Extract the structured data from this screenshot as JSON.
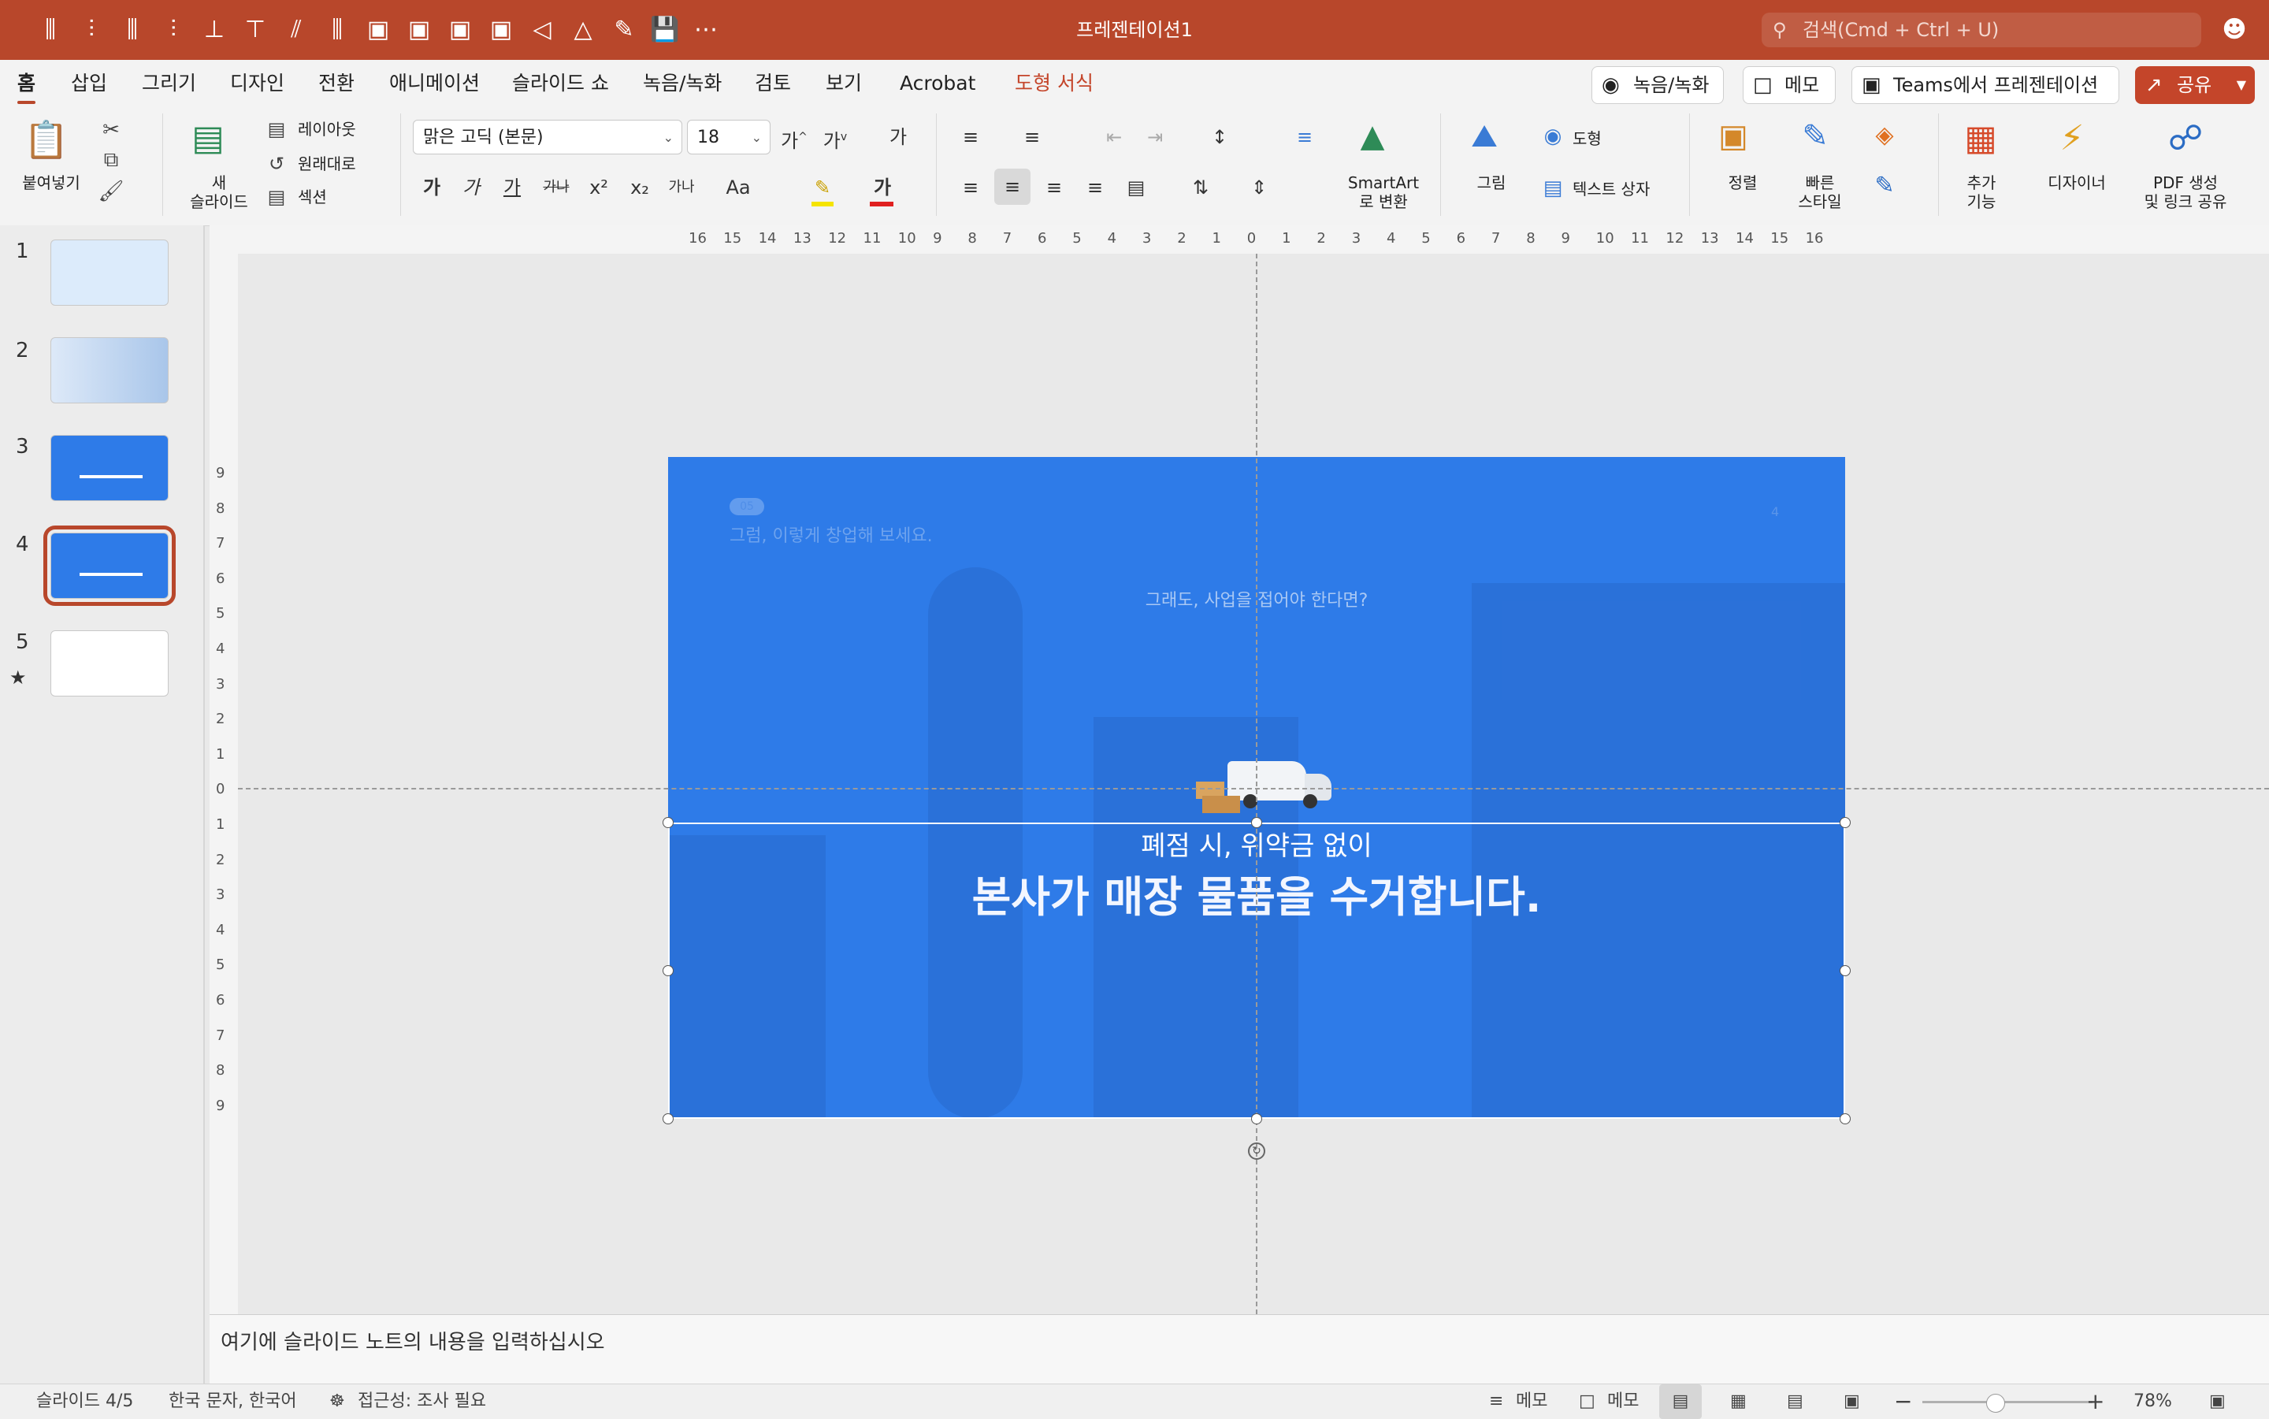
{
  "window": {
    "title": "프레젠테이션1",
    "search_placeholder": "검색(Cmd + Ctrl + U)",
    "accent_color": "#b8472b"
  },
  "quick_access_icons": [
    "align-center-icon",
    "align-middle-icon",
    "distribute-horizontal-icon",
    "align-vertical-center-icon",
    "align-bottom-icon",
    "align-top-icon",
    "align-right-icon",
    "align-left-icon",
    "bring-forward-icon",
    "send-backward-icon",
    "bring-to-front-icon",
    "send-to-back-icon",
    "flip-horizontal-icon",
    "flip-vertical-icon",
    "edit-icon",
    "save-icon",
    "more-icon"
  ],
  "tabs": [
    {
      "label": "홈",
      "active": true
    },
    {
      "label": "삽입"
    },
    {
      "label": "그리기"
    },
    {
      "label": "디자인"
    },
    {
      "label": "전환"
    },
    {
      "label": "애니메이션"
    },
    {
      "label": "슬라이드 쇼"
    },
    {
      "label": "녹음/녹화"
    },
    {
      "label": "검토"
    },
    {
      "label": "보기"
    },
    {
      "label": "Acrobat"
    },
    {
      "label": "도형 서식"
    }
  ],
  "ribbon_right": {
    "record": "녹음/녹화",
    "comment": "메모",
    "teams": "Teams에서 프레젠테이션",
    "share": "공유"
  },
  "ribbon": {
    "paste": "붙여넣기",
    "new_slide": "새\n슬라이드",
    "new_slide_l1": "새",
    "new_slide_l2": "슬라이드",
    "layout": "레이아웃",
    "reset": "원래대로",
    "section": "섹션",
    "font_name": "맑은 고딕 (본문)",
    "font_size": "18",
    "format_buttons": [
      "가",
      "가",
      "가",
      "가나",
      "x²",
      "x₂",
      "가나",
      "Aa"
    ],
    "smartart_l1": "SmartArt",
    "smartart_l2": "로 변환",
    "picture": "그림",
    "shape": "도형",
    "textbox": "텍스트 상자",
    "arrange": "정렬",
    "quick_styles_l1": "빠른",
    "quick_styles_l2": "스타일",
    "addins_l1": "추가",
    "addins_l2": "기능",
    "designer": "디자이너",
    "pdf_l1": "PDF 생성",
    "pdf_l2": "및 링크 공유"
  },
  "slides": [
    {
      "num": "1"
    },
    {
      "num": "2"
    },
    {
      "num": "3"
    },
    {
      "num": "4",
      "selected": true
    },
    {
      "num": "5",
      "star": "★"
    }
  ],
  "ruler": {
    "h_ticks": [
      "16",
      "15",
      "14",
      "13",
      "12",
      "11",
      "10",
      "9",
      "8",
      "7",
      "6",
      "5",
      "4",
      "3",
      "2",
      "1",
      "0",
      "1",
      "2",
      "3",
      "4",
      "5",
      "6",
      "7",
      "8",
      "9",
      "10",
      "11",
      "12",
      "13",
      "14",
      "15",
      "16"
    ],
    "v_ticks": [
      "9",
      "8",
      "7",
      "6",
      "5",
      "4",
      "3",
      "2",
      "1",
      "0",
      "1",
      "2",
      "3",
      "4",
      "5",
      "6",
      "7",
      "8",
      "9"
    ]
  },
  "slide_content": {
    "badge": "05",
    "top_subtitle": "그럼, 이렇게 창업해 보세요.",
    "page_number": "4",
    "question": "그래도, 사업을 접어야 한다면?",
    "line1": "폐점 시, 위약금 없이",
    "line2": "본사가 매장 물품을 수거합니다.",
    "bg_color": "#2e7be8"
  },
  "notes_placeholder": "여기에 슬라이드 노트의 내용을 입력하십시오",
  "status": {
    "slide_info": "슬라이드 4/5",
    "language": "한국 문자, 한국어",
    "accessibility": "접근성: 조사 필요",
    "notes_btn": "메모",
    "comments_btn": "메모",
    "zoom": "78%",
    "zoom_level": 0.78
  }
}
